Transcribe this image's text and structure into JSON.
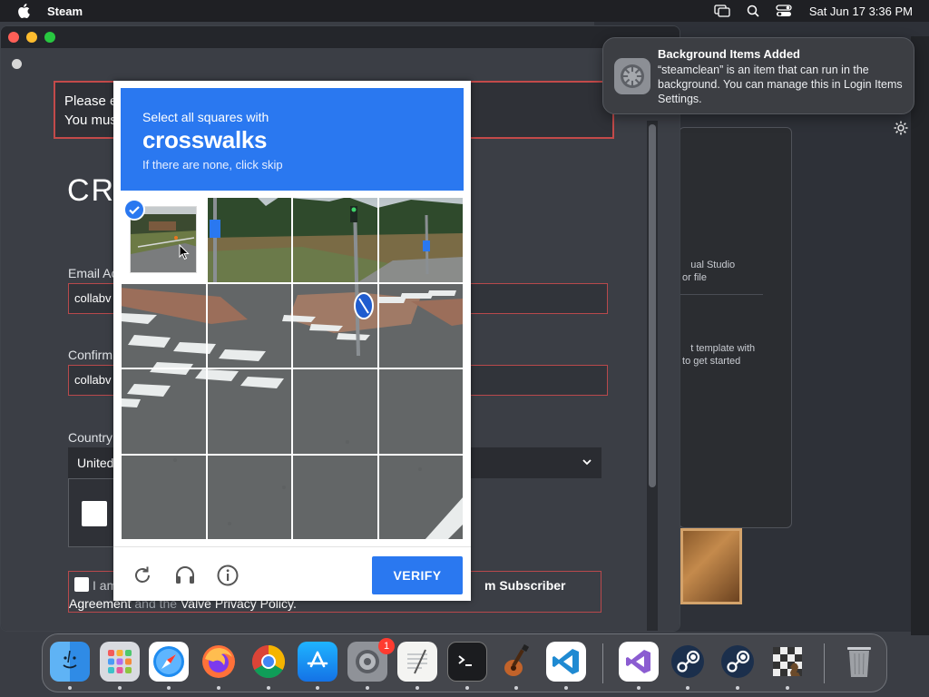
{
  "menubar": {
    "app_name": "Steam",
    "datetime": "Sat Jun 17  3:36 PM",
    "icons": [
      "apple-icon",
      "screen-mirroring-icon",
      "search-icon",
      "control-center-icon"
    ]
  },
  "steam_window": {
    "alert_line1": "Please e",
    "alert_line2": "You mus",
    "heading": "CRI",
    "email_label": "Email Ac",
    "email_value": "collabv",
    "confirm_label": "Confirm",
    "confirm_value": "collabv",
    "country_label": "Country",
    "country_value": "United",
    "agree_text1": "I am",
    "agree_text2": "m Subscriber",
    "agree_text3a": "Agreement",
    "agree_text3b": " and the ",
    "agree_text3c": "Valve Privacy Policy."
  },
  "captcha": {
    "instruction": "Select all squares with",
    "target": "crosswalks",
    "hint": "If there are none, click skip",
    "verify_label": "VERIFY",
    "selected_cells": [
      0
    ]
  },
  "background_panel": {
    "text1": "ual Studio\n or file",
    "text2": "t template with\n to get started"
  },
  "notification": {
    "title": "Background Items Added",
    "body": "“steamclean” is an item that can run in the background. You can manage this in Login Items Settings."
  },
  "dock": {
    "apps": [
      "Finder",
      "Launchpad",
      "Safari",
      "Firefox",
      "Chrome",
      "App Store",
      "System Settings",
      "TextEdit",
      "Terminal",
      "GarageBand",
      "Visual Studio Code",
      "Visual Studio",
      "Steam",
      "Steam",
      "Chess",
      "Trash"
    ],
    "settings_badge": "1"
  },
  "colors": {
    "captcha_blue": "#2a78f0",
    "error_red": "#c34a4a",
    "badge_red": "#ff3b30"
  }
}
